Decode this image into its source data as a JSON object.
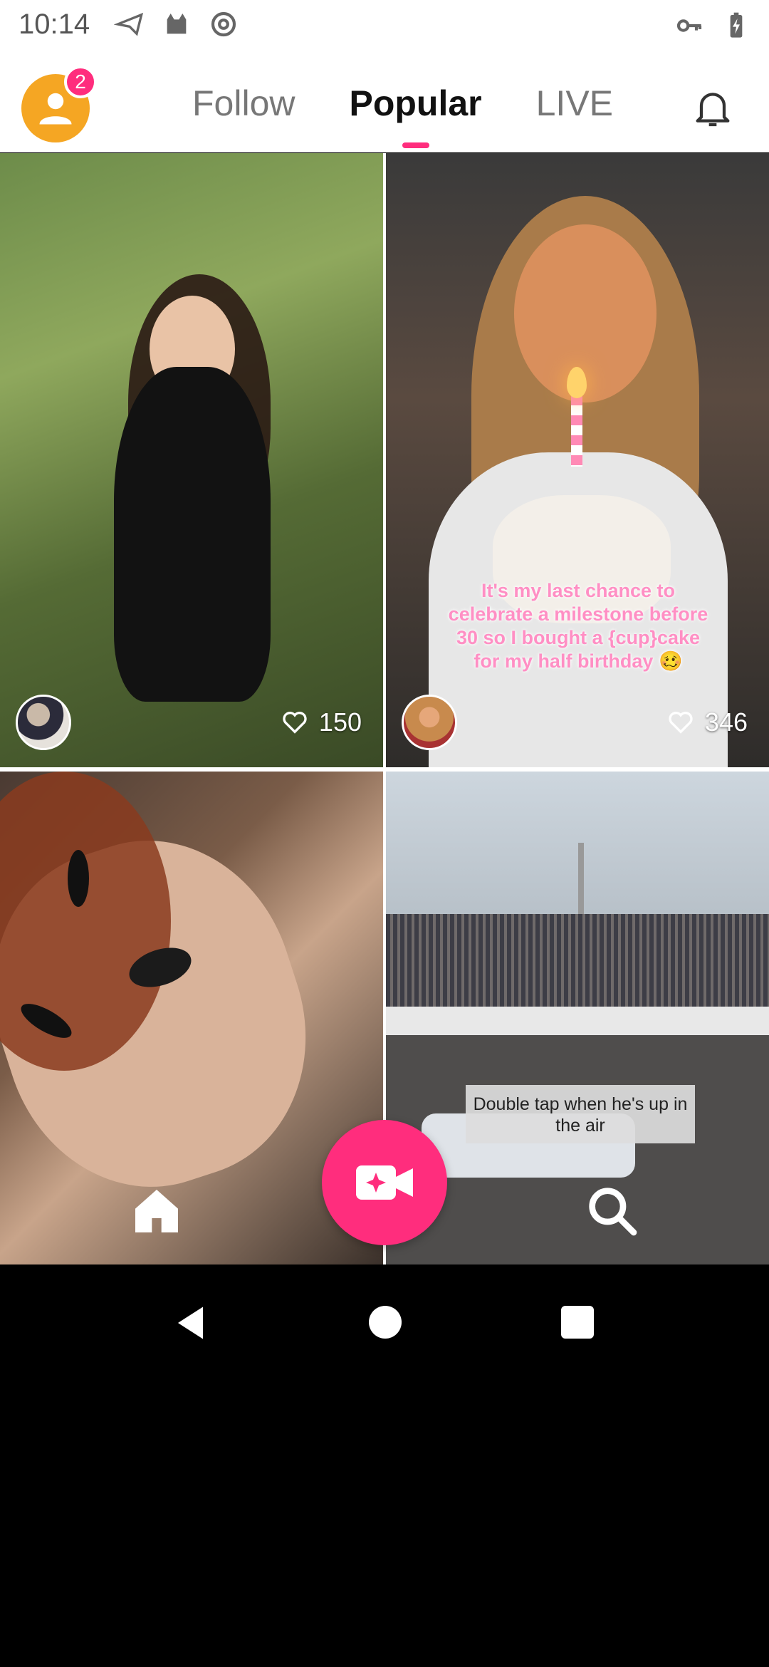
{
  "status_bar": {
    "time": "10:14",
    "left_icons": [
      "send-icon",
      "cat-icon",
      "at-sign-icon"
    ],
    "right_icons": [
      "key-icon",
      "battery-icon"
    ]
  },
  "top_nav": {
    "notification_badge": "2",
    "tabs": [
      {
        "label": "Follow",
        "active": false
      },
      {
        "label": "Popular",
        "active": true
      },
      {
        "label": "LIVE",
        "active": false
      }
    ],
    "accent_color": "#ff2d7d"
  },
  "feed": {
    "cards": [
      {
        "likes": "150",
        "caption": ""
      },
      {
        "likes": "346",
        "caption": "It's my last chance to celebrate a milestone before 30 so I bought a {cup}cake for my half birthday 🥴"
      },
      {
        "likes": "",
        "caption": ""
      },
      {
        "likes": "",
        "caption": "Double tap when he's up in the air"
      }
    ]
  },
  "bottom_nav": {
    "items": [
      "home-icon",
      "record-video-icon",
      "search-icon"
    ]
  }
}
